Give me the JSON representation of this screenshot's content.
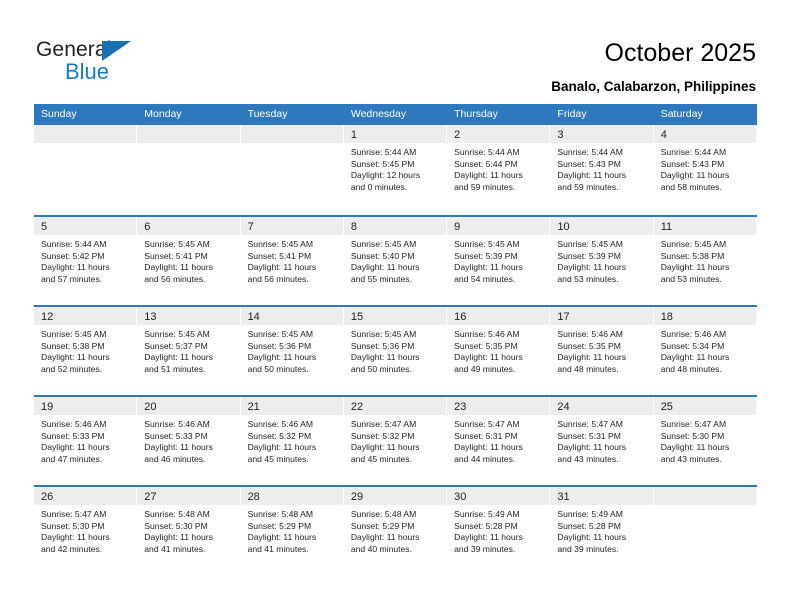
{
  "logo": {
    "word_top": "General",
    "word_bottom": "Blue",
    "triangle_color": "#1a6fb5",
    "blue_color": "#1b7cc4"
  },
  "header": {
    "title": "October 2025",
    "location": "Banalo, Calabarzon, Philippines"
  },
  "theme": {
    "header_blue": "#2e79bd",
    "daynum_band": "#ededed",
    "cell_background": "#ffffff",
    "text": "#231f20"
  },
  "calendar": {
    "weekdays": [
      "Sunday",
      "Monday",
      "Tuesday",
      "Wednesday",
      "Thursday",
      "Friday",
      "Saturday"
    ],
    "weeks": [
      [
        {
          "day": "",
          "lines": []
        },
        {
          "day": "",
          "lines": []
        },
        {
          "day": "",
          "lines": []
        },
        {
          "day": "1",
          "lines": [
            "Sunrise: 5:44 AM",
            "Sunset: 5:45 PM",
            "Daylight: 12 hours",
            "and 0 minutes."
          ]
        },
        {
          "day": "2",
          "lines": [
            "Sunrise: 5:44 AM",
            "Sunset: 5:44 PM",
            "Daylight: 11 hours",
            "and 59 minutes."
          ]
        },
        {
          "day": "3",
          "lines": [
            "Sunrise: 5:44 AM",
            "Sunset: 5:43 PM",
            "Daylight: 11 hours",
            "and 59 minutes."
          ]
        },
        {
          "day": "4",
          "lines": [
            "Sunrise: 5:44 AM",
            "Sunset: 5:43 PM",
            "Daylight: 11 hours",
            "and 58 minutes."
          ]
        }
      ],
      [
        {
          "day": "5",
          "lines": [
            "Sunrise: 5:44 AM",
            "Sunset: 5:42 PM",
            "Daylight: 11 hours",
            "and 57 minutes."
          ]
        },
        {
          "day": "6",
          "lines": [
            "Sunrise: 5:45 AM",
            "Sunset: 5:41 PM",
            "Daylight: 11 hours",
            "and 56 minutes."
          ]
        },
        {
          "day": "7",
          "lines": [
            "Sunrise: 5:45 AM",
            "Sunset: 5:41 PM",
            "Daylight: 11 hours",
            "and 56 minutes."
          ]
        },
        {
          "day": "8",
          "lines": [
            "Sunrise: 5:45 AM",
            "Sunset: 5:40 PM",
            "Daylight: 11 hours",
            "and 55 minutes."
          ]
        },
        {
          "day": "9",
          "lines": [
            "Sunrise: 5:45 AM",
            "Sunset: 5:39 PM",
            "Daylight: 11 hours",
            "and 54 minutes."
          ]
        },
        {
          "day": "10",
          "lines": [
            "Sunrise: 5:45 AM",
            "Sunset: 5:39 PM",
            "Daylight: 11 hours",
            "and 53 minutes."
          ]
        },
        {
          "day": "11",
          "lines": [
            "Sunrise: 5:45 AM",
            "Sunset: 5:38 PM",
            "Daylight: 11 hours",
            "and 53 minutes."
          ]
        }
      ],
      [
        {
          "day": "12",
          "lines": [
            "Sunrise: 5:45 AM",
            "Sunset: 5:38 PM",
            "Daylight: 11 hours",
            "and 52 minutes."
          ]
        },
        {
          "day": "13",
          "lines": [
            "Sunrise: 5:45 AM",
            "Sunset: 5:37 PM",
            "Daylight: 11 hours",
            "and 51 minutes."
          ]
        },
        {
          "day": "14",
          "lines": [
            "Sunrise: 5:45 AM",
            "Sunset: 5:36 PM",
            "Daylight: 11 hours",
            "and 50 minutes."
          ]
        },
        {
          "day": "15",
          "lines": [
            "Sunrise: 5:45 AM",
            "Sunset: 5:36 PM",
            "Daylight: 11 hours",
            "and 50 minutes."
          ]
        },
        {
          "day": "16",
          "lines": [
            "Sunrise: 5:46 AM",
            "Sunset: 5:35 PM",
            "Daylight: 11 hours",
            "and 49 minutes."
          ]
        },
        {
          "day": "17",
          "lines": [
            "Sunrise: 5:46 AM",
            "Sunset: 5:35 PM",
            "Daylight: 11 hours",
            "and 48 minutes."
          ]
        },
        {
          "day": "18",
          "lines": [
            "Sunrise: 5:46 AM",
            "Sunset: 5:34 PM",
            "Daylight: 11 hours",
            "and 48 minutes."
          ]
        }
      ],
      [
        {
          "day": "19",
          "lines": [
            "Sunrise: 5:46 AM",
            "Sunset: 5:33 PM",
            "Daylight: 11 hours",
            "and 47 minutes."
          ]
        },
        {
          "day": "20",
          "lines": [
            "Sunrise: 5:46 AM",
            "Sunset: 5:33 PM",
            "Daylight: 11 hours",
            "and 46 minutes."
          ]
        },
        {
          "day": "21",
          "lines": [
            "Sunrise: 5:46 AM",
            "Sunset: 5:32 PM",
            "Daylight: 11 hours",
            "and 45 minutes."
          ]
        },
        {
          "day": "22",
          "lines": [
            "Sunrise: 5:47 AM",
            "Sunset: 5:32 PM",
            "Daylight: 11 hours",
            "and 45 minutes."
          ]
        },
        {
          "day": "23",
          "lines": [
            "Sunrise: 5:47 AM",
            "Sunset: 5:31 PM",
            "Daylight: 11 hours",
            "and 44 minutes."
          ]
        },
        {
          "day": "24",
          "lines": [
            "Sunrise: 5:47 AM",
            "Sunset: 5:31 PM",
            "Daylight: 11 hours",
            "and 43 minutes."
          ]
        },
        {
          "day": "25",
          "lines": [
            "Sunrise: 5:47 AM",
            "Sunset: 5:30 PM",
            "Daylight: 11 hours",
            "and 43 minutes."
          ]
        }
      ],
      [
        {
          "day": "26",
          "lines": [
            "Sunrise: 5:47 AM",
            "Sunset: 5:30 PM",
            "Daylight: 11 hours",
            "and 42 minutes."
          ]
        },
        {
          "day": "27",
          "lines": [
            "Sunrise: 5:48 AM",
            "Sunset: 5:30 PM",
            "Daylight: 11 hours",
            "and 41 minutes."
          ]
        },
        {
          "day": "28",
          "lines": [
            "Sunrise: 5:48 AM",
            "Sunset: 5:29 PM",
            "Daylight: 11 hours",
            "and 41 minutes."
          ]
        },
        {
          "day": "29",
          "lines": [
            "Sunrise: 5:48 AM",
            "Sunset: 5:29 PM",
            "Daylight: 11 hours",
            "and 40 minutes."
          ]
        },
        {
          "day": "30",
          "lines": [
            "Sunrise: 5:49 AM",
            "Sunset: 5:28 PM",
            "Daylight: 11 hours",
            "and 39 minutes."
          ]
        },
        {
          "day": "31",
          "lines": [
            "Sunrise: 5:49 AM",
            "Sunset: 5:28 PM",
            "Daylight: 11 hours",
            "and 39 minutes."
          ]
        },
        {
          "day": "",
          "lines": []
        }
      ]
    ]
  }
}
